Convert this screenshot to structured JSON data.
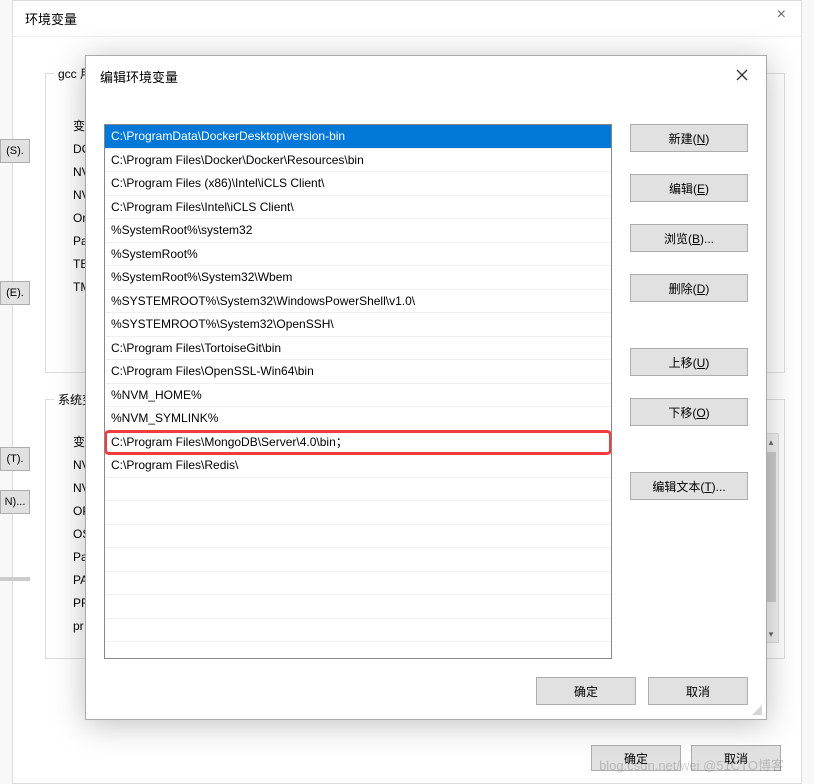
{
  "bg_window": {
    "title": "环境变量",
    "group1_label": "gcc 用户变量",
    "group2_label": "系统变量",
    "list1_header": "变量",
    "list1": [
      "DO",
      "NV",
      "NV",
      "Or",
      "Pa",
      "TE",
      "TM"
    ],
    "list2_header": "变量",
    "list2": [
      "NV",
      "NV",
      "OP",
      "OS",
      "Pa",
      "PA",
      "PR",
      "pr"
    ],
    "left_btn_s": "(S).",
    "left_btn_e": "(E).",
    "left_btn_t": "(T).",
    "left_btn_n": "N)...",
    "ok": "确定",
    "cancel": "取消"
  },
  "dialog": {
    "title": "编辑环境变量",
    "paths": [
      "C:\\ProgramData\\DockerDesktop\\version-bin",
      "C:\\Program Files\\Docker\\Docker\\Resources\\bin",
      "C:\\Program Files (x86)\\Intel\\iCLS Client\\",
      "C:\\Program Files\\Intel\\iCLS Client\\",
      "%SystemRoot%\\system32",
      "%SystemRoot%",
      "%SystemRoot%\\System32\\Wbem",
      "%SYSTEMROOT%\\System32\\WindowsPowerShell\\v1.0\\",
      "%SYSTEMROOT%\\System32\\OpenSSH\\",
      "C:\\Program Files\\TortoiseGit\\bin",
      "C:\\Program Files\\OpenSSL-Win64\\bin",
      "%NVM_HOME%",
      "%NVM_SYMLINK%",
      "C:\\Program Files\\MongoDB\\Server\\4.0\\bin；",
      "C:\\Program Files\\Redis\\"
    ],
    "selected_index": 0,
    "highlighted_index": 13,
    "buttons": {
      "new": "新建(N)",
      "edit": "编辑(E)",
      "browse": "浏览(B)...",
      "delete": "删除(D)",
      "move_up": "上移(U)",
      "move_down": "下移(O)",
      "edit_text": "编辑文本(T)..."
    },
    "ok": "确定",
    "cancel": "取消"
  },
  "watermark": "blog.csdn.net/wei @51CTO博客"
}
